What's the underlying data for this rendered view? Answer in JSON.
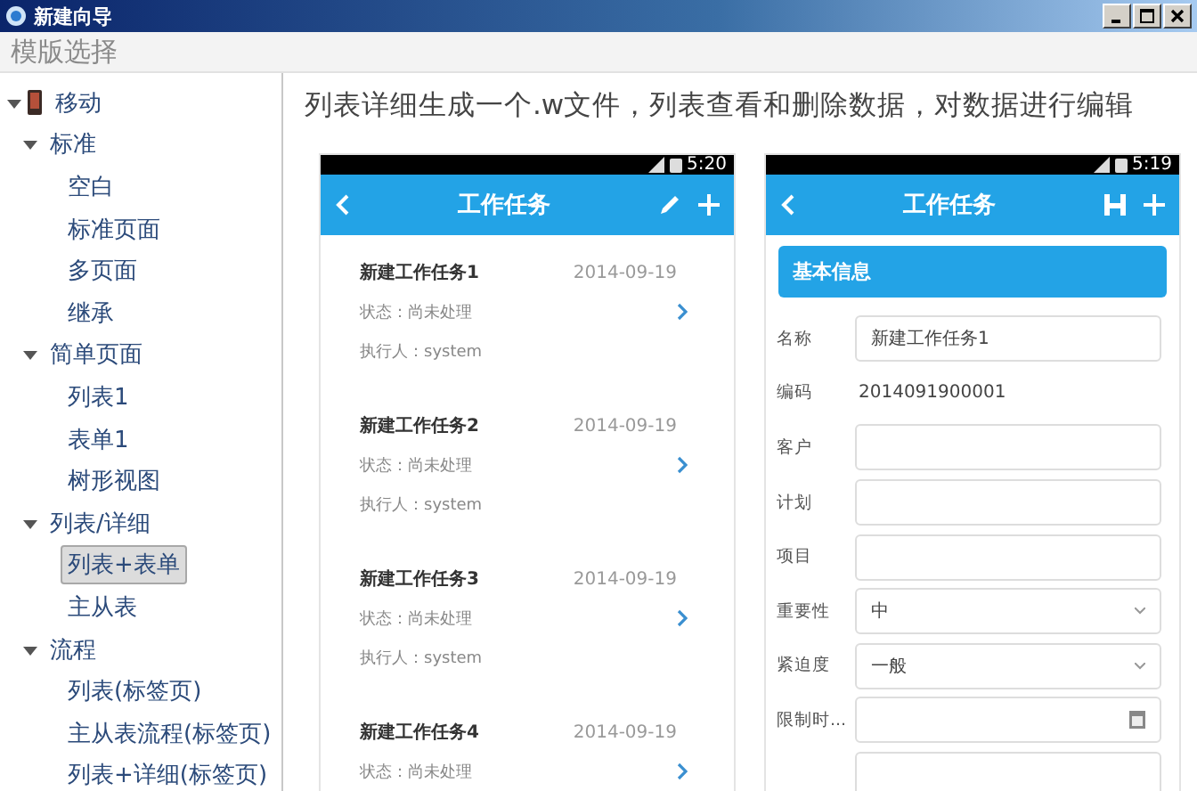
{
  "window": {
    "title": "新建向导"
  },
  "toolbar": {
    "label": "模版选择"
  },
  "tree": [
    {
      "label": "移动",
      "kind": "root",
      "expanded": true,
      "selected": false,
      "children": [
        {
          "label": "标准",
          "expanded": true,
          "selected": false,
          "children": [
            {
              "label": "空白",
              "selected": false
            },
            {
              "label": "标准页面",
              "selected": false
            },
            {
              "label": "多页面",
              "selected": false
            },
            {
              "label": "继承",
              "selected": false
            }
          ]
        },
        {
          "label": "简单页面",
          "expanded": true,
          "selected": false,
          "children": [
            {
              "label": "列表1",
              "selected": false
            },
            {
              "label": "表单1",
              "selected": false
            },
            {
              "label": "树形视图",
              "selected": false
            }
          ]
        },
        {
          "label": "列表/详细",
          "expanded": true,
          "selected": false,
          "children": [
            {
              "label": "列表+表单",
              "selected": true
            },
            {
              "label": "主从表",
              "selected": false
            }
          ]
        },
        {
          "label": "流程",
          "expanded": true,
          "selected": false,
          "children": [
            {
              "label": "列表(标签页)",
              "selected": false
            },
            {
              "label": "主从表流程(标签页)",
              "selected": false
            },
            {
              "label": "列表+详细(标签页)",
              "selected": false
            }
          ]
        }
      ]
    }
  ],
  "heading": "列表详细生成一个.w文件，列表查看和删除数据，对数据进行编辑",
  "phones": [
    {
      "kind": "list",
      "time": "5:20",
      "title": "工作任务",
      "items": [
        {
          "title": "新建工作任务1",
          "date": "2014-09-19",
          "status": "状态：尚未处理",
          "executor": "执行人：system"
        },
        {
          "title": "新建工作任务2",
          "date": "2014-09-19",
          "status": "状态：尚未处理",
          "executor": "执行人：system"
        },
        {
          "title": "新建工作任务3",
          "date": "2014-09-19",
          "status": "状态：尚未处理",
          "executor": "执行人：system"
        },
        {
          "title": "新建工作任务4",
          "date": "2014-09-19",
          "status": "状态：尚未处理"
        }
      ]
    },
    {
      "kind": "form",
      "time": "5:19",
      "title": "工作任务",
      "section": "基本信息",
      "fields": [
        {
          "kind": "input",
          "label": "名称",
          "value": "新建工作任务1"
        },
        {
          "kind": "text",
          "label": "编码",
          "value": "2014091900001"
        },
        {
          "kind": "input",
          "label": "客户"
        },
        {
          "kind": "input",
          "label": "计划"
        },
        {
          "kind": "input",
          "label": "项目"
        },
        {
          "kind": "select",
          "label": "重要性",
          "value": "中"
        },
        {
          "kind": "select",
          "label": "紧迫度",
          "value": "一般"
        },
        {
          "kind": "date",
          "label": "限制时..."
        },
        {
          "kind": "input"
        }
      ]
    }
  ]
}
